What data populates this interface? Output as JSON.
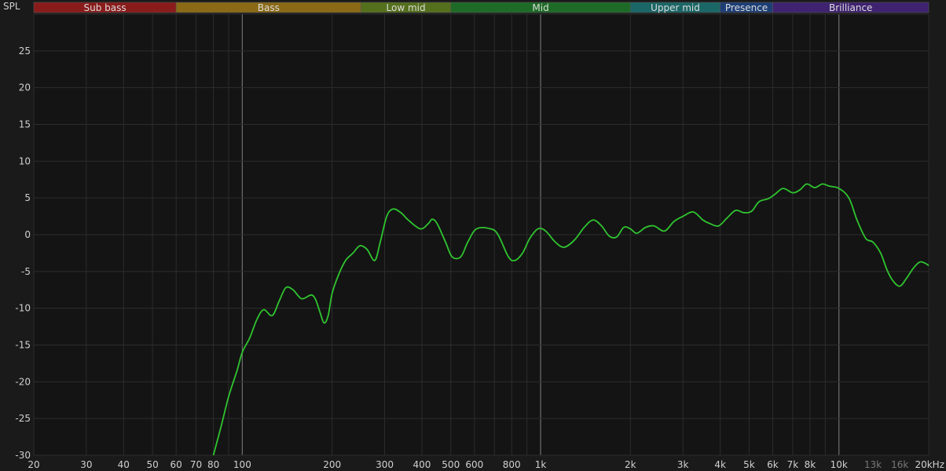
{
  "chart_data": {
    "type": "line",
    "ylabel": "SPL",
    "xscale": "log",
    "xlim": [
      20,
      20000
    ],
    "ylim": [
      -30,
      30
    ],
    "yticks": [
      -30,
      -25,
      -20,
      -15,
      -10,
      -5,
      0,
      5,
      10,
      15,
      20,
      25
    ],
    "xtick_labels": [
      {
        "value": 20,
        "label": "20"
      },
      {
        "value": 30,
        "label": "30"
      },
      {
        "value": 40,
        "label": "40"
      },
      {
        "value": 50,
        "label": "50"
      },
      {
        "value": 60,
        "label": "60"
      },
      {
        "value": 70,
        "label": "70"
      },
      {
        "value": 80,
        "label": "80"
      },
      {
        "value": 100,
        "label": "100"
      },
      {
        "value": 200,
        "label": "200"
      },
      {
        "value": 300,
        "label": "300"
      },
      {
        "value": 400,
        "label": "400"
      },
      {
        "value": 500,
        "label": "500"
      },
      {
        "value": 600,
        "label": "600"
      },
      {
        "value": 800,
        "label": "800"
      },
      {
        "value": 1000,
        "label": "1k"
      },
      {
        "value": 2000,
        "label": "2k"
      },
      {
        "value": 3000,
        "label": "3k"
      },
      {
        "value": 4000,
        "label": "4k"
      },
      {
        "value": 5000,
        "label": "5k"
      },
      {
        "value": 6000,
        "label": "6k"
      },
      {
        "value": 7000,
        "label": "7k"
      },
      {
        "value": 8000,
        "label": "8k"
      },
      {
        "value": 10000,
        "label": "10k"
      },
      {
        "value": 13000,
        "label": "13k",
        "dim": true
      },
      {
        "value": 16000,
        "label": "16k",
        "dim": true
      },
      {
        "value": 20000,
        "label": "20kHz"
      }
    ],
    "grid": true,
    "bands": [
      {
        "name": "Sub bass",
        "from": 20,
        "to": 60,
        "color": "#8a1b1b"
      },
      {
        "name": "Bass",
        "from": 60,
        "to": 250,
        "color": "#8a6a16"
      },
      {
        "name": "Low mid",
        "from": 250,
        "to": 500,
        "color": "#55701c"
      },
      {
        "name": "Mid",
        "from": 500,
        "to": 2000,
        "color": "#1d6b26"
      },
      {
        "name": "Upper mid",
        "from": 2000,
        "to": 4000,
        "color": "#1b6666"
      },
      {
        "name": "Presence",
        "from": 4000,
        "to": 6000,
        "color": "#1d3e75"
      },
      {
        "name": "Brilliance",
        "from": 6000,
        "to": 20000,
        "color": "#3f2270"
      }
    ],
    "series": [
      {
        "color": "#2fc42f",
        "points": [
          [
            80,
            -30
          ],
          [
            85,
            -26
          ],
          [
            90,
            -22
          ],
          [
            96,
            -18.5
          ],
          [
            100,
            -16
          ],
          [
            106,
            -14
          ],
          [
            112,
            -11.5
          ],
          [
            118,
            -10.2
          ],
          [
            126,
            -11
          ],
          [
            133,
            -9
          ],
          [
            140,
            -7.2
          ],
          [
            148,
            -7.5
          ],
          [
            158,
            -8.7
          ],
          [
            170,
            -8.2
          ],
          [
            176,
            -8.8
          ],
          [
            182,
            -10.5
          ],
          [
            188,
            -12
          ],
          [
            194,
            -11
          ],
          [
            200,
            -8
          ],
          [
            210,
            -5.5
          ],
          [
            222,
            -3.5
          ],
          [
            235,
            -2.5
          ],
          [
            248,
            -1.5
          ],
          [
            262,
            -2
          ],
          [
            278,
            -3.5
          ],
          [
            290,
            -1
          ],
          [
            305,
            2.5
          ],
          [
            320,
            3.5
          ],
          [
            340,
            3
          ],
          [
            360,
            2
          ],
          [
            395,
            0.8
          ],
          [
            420,
            1.5
          ],
          [
            433,
            2.1
          ],
          [
            450,
            1.5
          ],
          [
            480,
            -1
          ],
          [
            505,
            -3
          ],
          [
            540,
            -3
          ],
          [
            570,
            -1
          ],
          [
            610,
            0.8
          ],
          [
            680,
            0.8
          ],
          [
            720,
            0
          ],
          [
            780,
            -3
          ],
          [
            820,
            -3.5
          ],
          [
            870,
            -2.5
          ],
          [
            920,
            -0.5
          ],
          [
            980,
            0.8
          ],
          [
            1040,
            0.5
          ],
          [
            1120,
            -1
          ],
          [
            1200,
            -1.7
          ],
          [
            1300,
            -0.7
          ],
          [
            1400,
            1
          ],
          [
            1500,
            2
          ],
          [
            1600,
            1.2
          ],
          [
            1700,
            -0.2
          ],
          [
            1800,
            -0.3
          ],
          [
            1900,
            1
          ],
          [
            2000,
            0.8
          ],
          [
            2100,
            0.2
          ],
          [
            2250,
            1
          ],
          [
            2400,
            1.2
          ],
          [
            2600,
            0.5
          ],
          [
            2800,
            1.8
          ],
          [
            3000,
            2.5
          ],
          [
            3250,
            3.1
          ],
          [
            3500,
            2
          ],
          [
            3700,
            1.5
          ],
          [
            3950,
            1.2
          ],
          [
            4200,
            2.2
          ],
          [
            4500,
            3.3
          ],
          [
            4800,
            3
          ],
          [
            5100,
            3.2
          ],
          [
            5400,
            4.5
          ],
          [
            5800,
            4.9
          ],
          [
            6100,
            5.5
          ],
          [
            6500,
            6.3
          ],
          [
            7000,
            5.7
          ],
          [
            7400,
            6.1
          ],
          [
            7800,
            6.9
          ],
          [
            8300,
            6.4
          ],
          [
            8800,
            6.9
          ],
          [
            9300,
            6.6
          ],
          [
            10000,
            6.3
          ],
          [
            10800,
            5
          ],
          [
            11500,
            2
          ],
          [
            12300,
            -0.5
          ],
          [
            13000,
            -1
          ],
          [
            13800,
            -2.5
          ],
          [
            14500,
            -4.8
          ],
          [
            15200,
            -6.3
          ],
          [
            16000,
            -7
          ],
          [
            16800,
            -6
          ],
          [
            17800,
            -4.5
          ],
          [
            18700,
            -3.7
          ],
          [
            19500,
            -3.9
          ],
          [
            20000,
            -4.2
          ]
        ]
      }
    ]
  }
}
